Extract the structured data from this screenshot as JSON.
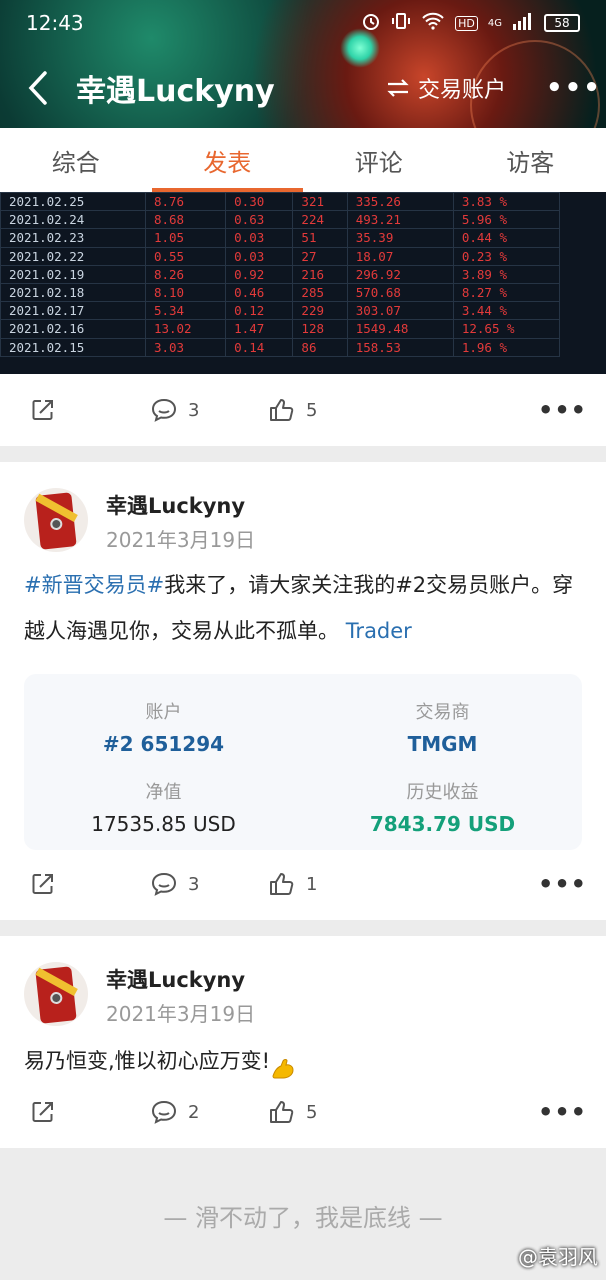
{
  "status_bar": {
    "time": "12:43",
    "network": "4G",
    "hd": "HD",
    "battery": "58"
  },
  "nav": {
    "title": "幸遇Luckyny",
    "switch_label": "交易账户"
  },
  "tabs": [
    {
      "label": "综合",
      "active": false
    },
    {
      "label": "发表",
      "active": true
    },
    {
      "label": "评论",
      "active": false
    },
    {
      "label": "访客",
      "active": false
    }
  ],
  "trade_table": {
    "rows": [
      [
        "2021.02.25",
        "8.76",
        "0.30",
        "321",
        "335.26",
        "3.83 %"
      ],
      [
        "2021.02.24",
        "8.68",
        "0.63",
        "224",
        "493.21",
        "5.96 %"
      ],
      [
        "2021.02.23",
        "1.05",
        "0.03",
        "51",
        "35.39",
        "0.44 %"
      ],
      [
        "2021.02.22",
        "0.55",
        "0.03",
        "27",
        "18.07",
        "0.23 %"
      ],
      [
        "2021.02.19",
        "8.26",
        "0.92",
        "216",
        "296.92",
        "3.89 %"
      ],
      [
        "2021.02.18",
        "8.10",
        "0.46",
        "285",
        "570.68",
        "8.27 %"
      ],
      [
        "2021.02.17",
        "5.34",
        "0.12",
        "229",
        "303.07",
        "3.44 %"
      ],
      [
        "2021.02.16",
        "13.02",
        "1.47",
        "128",
        "1549.48",
        "12.65 %"
      ],
      [
        "2021.02.15",
        "3.03",
        "0.14",
        "86",
        "158.53",
        "1.96 %"
      ]
    ]
  },
  "actions_1": {
    "comments": "3",
    "likes": "5"
  },
  "post_2": {
    "author": "幸遇Luckyny",
    "date": "2021年3月19日",
    "topic": "#新晋交易员#",
    "text": "我来了，请大家关注我的#2交易员账户。穿越人海遇见你，交易从此不孤单。",
    "link": "Trader",
    "account": {
      "account_label": "账户",
      "account_value": "#2 651294",
      "broker_label": "交易商",
      "broker_value": "TMGM",
      "equity_label": "净值",
      "equity_value": "17535.85 USD",
      "profit_label": "历史收益",
      "profit_value": "7843.79 USD"
    },
    "comments": "3",
    "likes": "1"
  },
  "post_3": {
    "author": "幸遇Luckyny",
    "date": "2021年3月19日",
    "text": "易乃恒变,惟以初心应万变!",
    "emoji": "flexed-biceps",
    "comments": "2",
    "likes": "5"
  },
  "footer": {
    "end_text": "— 滑不动了，我是底线 —",
    "watermark": "@袁羽风"
  }
}
